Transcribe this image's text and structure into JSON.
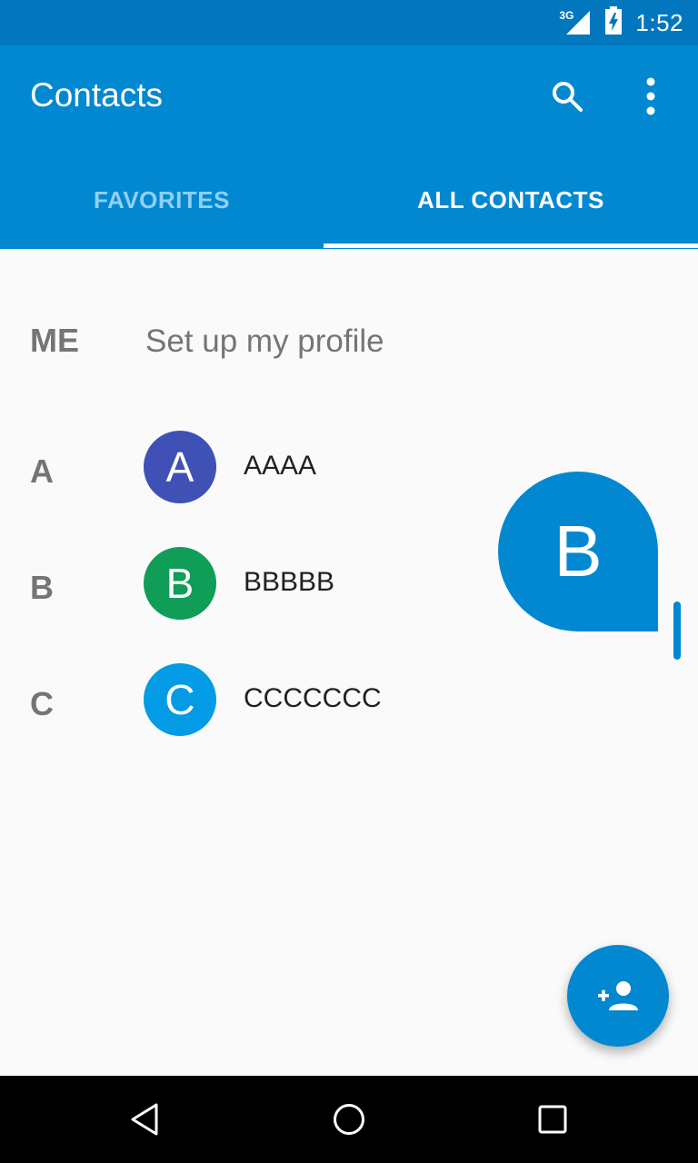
{
  "status_bar": {
    "time": "1:52",
    "network": "3G",
    "icons": [
      "signal-icon",
      "battery-icon"
    ]
  },
  "app_bar": {
    "title": "Contacts",
    "icons": [
      "search-icon",
      "more-vert-icon"
    ],
    "color": "#0288d1"
  },
  "tabs": [
    {
      "label": "FAVORITES",
      "selected": false
    },
    {
      "label": "ALL CONTACTS",
      "selected": true
    }
  ],
  "me": {
    "label": "ME",
    "text": "Set up my profile"
  },
  "contacts": [
    {
      "section": "A",
      "initial": "A",
      "name": "AAAA",
      "color": "#3f51b5"
    },
    {
      "section": "B",
      "initial": "B",
      "name": "BBBBB",
      "color": "#0f9d58"
    },
    {
      "section": "C",
      "initial": "C",
      "name": "CCCCCCC",
      "color": "#039be5"
    }
  ],
  "fast_scroll": {
    "letter": "B"
  },
  "fab": {
    "icon": "add-person-icon"
  },
  "nav_bar": {
    "icons": [
      "back-icon",
      "home-icon",
      "recents-icon"
    ]
  }
}
